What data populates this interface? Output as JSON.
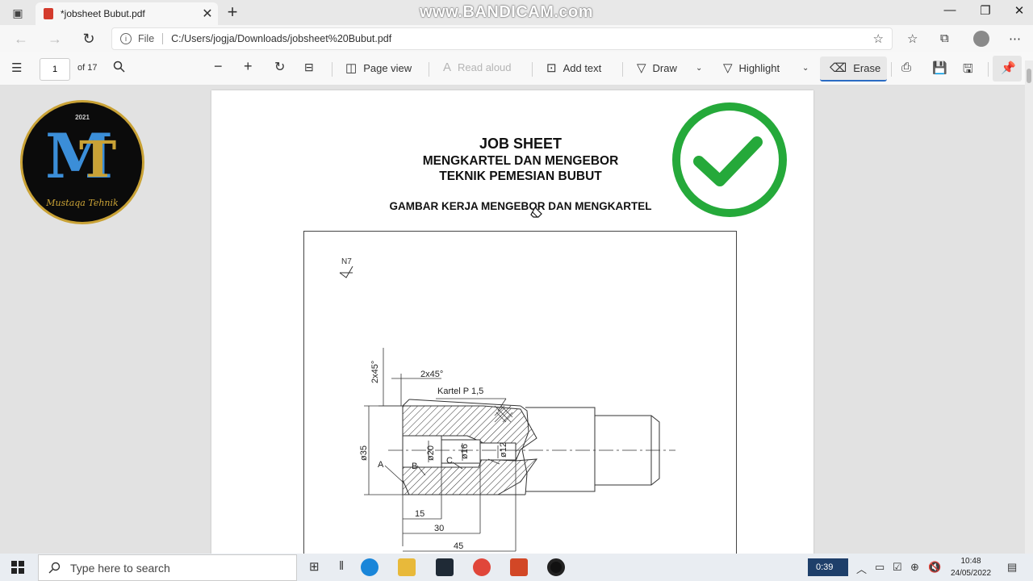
{
  "browser": {
    "tab_title": "*jobsheet Bubut.pdf",
    "watermark": "www.BANDICAM.com",
    "url_prefix": "File",
    "url": "C:/Users/jogja/Downloads/jobsheet%20Bubut.pdf"
  },
  "pdf_toolbar": {
    "page_number": "1",
    "page_total": "of 17",
    "page_view": "Page view",
    "read_aloud": "Read aloud",
    "add_text": "Add text",
    "draw": "Draw",
    "highlight": "Highlight",
    "erase": "Erase"
  },
  "logo": {
    "year": "2021",
    "letters": "MT",
    "name": "Mustaqa Tehnik"
  },
  "document": {
    "title": "JOB SHEET",
    "subtitle1": "MENGKARTEL DAN MENGEBOR",
    "subtitle2": "TEKNIK PEMESIAN BUBUT",
    "drawing_title": "GAMBAR KERJA MENGEBOR DAN MENGKARTEL",
    "surface_symbol": "N7",
    "dims": {
      "chamfer_v": "2x45°",
      "chamfer_h": "2x45°",
      "knurl": "Kartel P 1,5",
      "d35": "ø35",
      "d20": "ø20",
      "d16": "ø16",
      "d12": "ø12",
      "l15": "15",
      "l30": "30",
      "l45": "45",
      "a": "A",
      "b": "B",
      "c": "C"
    }
  },
  "taskbar": {
    "search_placeholder": "Type here to search",
    "timer": "0:39",
    "time": "10:48",
    "date": "24/05/2022"
  },
  "colors": {
    "check_green": "#25a93a",
    "logo_gold": "#c9a236",
    "logo_blue": "#3b8ed8",
    "erase_underline": "#2b6cc4"
  }
}
